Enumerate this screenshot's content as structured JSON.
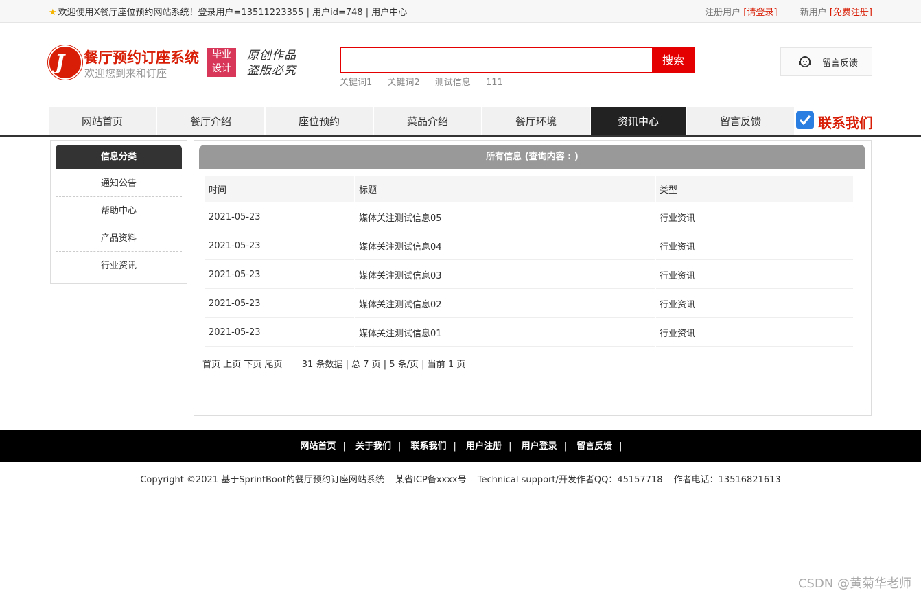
{
  "topbar": {
    "welcome": "欢迎使用X餐厅座位预约网站系统！登录用户=13511223355 | 用户id=748 | 用户中心",
    "register_user_label": "注册用户",
    "login_link": "[请登录]",
    "new_user_label": "新用户",
    "free_register_link": "[免费注册]"
  },
  "header": {
    "logo_glyph": "J",
    "site_title": "餐厅预约订座系统",
    "site_subtitle": "欢迎您到来和订座",
    "badge_line1": "毕业",
    "badge_line2": "设计",
    "motto_line1": "原创作品",
    "motto_line2": "盗版必究",
    "search_value": "",
    "search_button": "搜索",
    "hot_words": [
      "关键词1",
      "关键词2",
      "测试信息",
      "111"
    ],
    "feedback_label": "留言反馈"
  },
  "nav": {
    "items": [
      "网站首页",
      "餐厅介绍",
      "座位预约",
      "菜品介绍",
      "餐厅环境",
      "资讯中心",
      "留言反馈"
    ],
    "active": "资讯中心",
    "contact_label": "联系我们"
  },
  "sidebar": {
    "title": "信息分类",
    "links": [
      "通知公告",
      "帮助中心",
      "产品资料",
      "行业资讯"
    ]
  },
  "main": {
    "title": "所有信息 (查询内容 : )",
    "columns": [
      "时间",
      "标题",
      "类型"
    ],
    "rows": [
      [
        "2021-05-23",
        "媒体关注测试信息05",
        "行业资讯"
      ],
      [
        "2021-05-23",
        "媒体关注测试信息04",
        "行业资讯"
      ],
      [
        "2021-05-23",
        "媒体关注测试信息03",
        "行业资讯"
      ],
      [
        "2021-05-23",
        "媒体关注测试信息02",
        "行业资讯"
      ],
      [
        "2021-05-23",
        "媒体关注测试信息01",
        "行业资讯"
      ]
    ],
    "pager": {
      "first": "首页",
      "prev": "上页",
      "next": "下页",
      "last": "尾页",
      "summary": "31 条数据 | 总 7 页 | 5 条/页 | 当前 1 页"
    }
  },
  "footer": {
    "links": [
      "网站首页",
      "关于我们",
      "联系我们",
      "用户注册",
      "用户登录",
      "留言反馈"
    ],
    "separator": "|",
    "copyright": "Copyright ©2021 基于SprintBoot的餐厅预约订座网站系统",
    "icp": "某省ICP备xxxx号",
    "support": "Technical support/开发作者QQ：45157718",
    "phone": "作者电话：13516821613"
  },
  "watermark": "CSDN @黄菊华老师",
  "colors": {
    "brand_red": "#d81e06",
    "search_red": "#e40000",
    "nav_active": "#222222",
    "footer_bg": "#000000"
  }
}
